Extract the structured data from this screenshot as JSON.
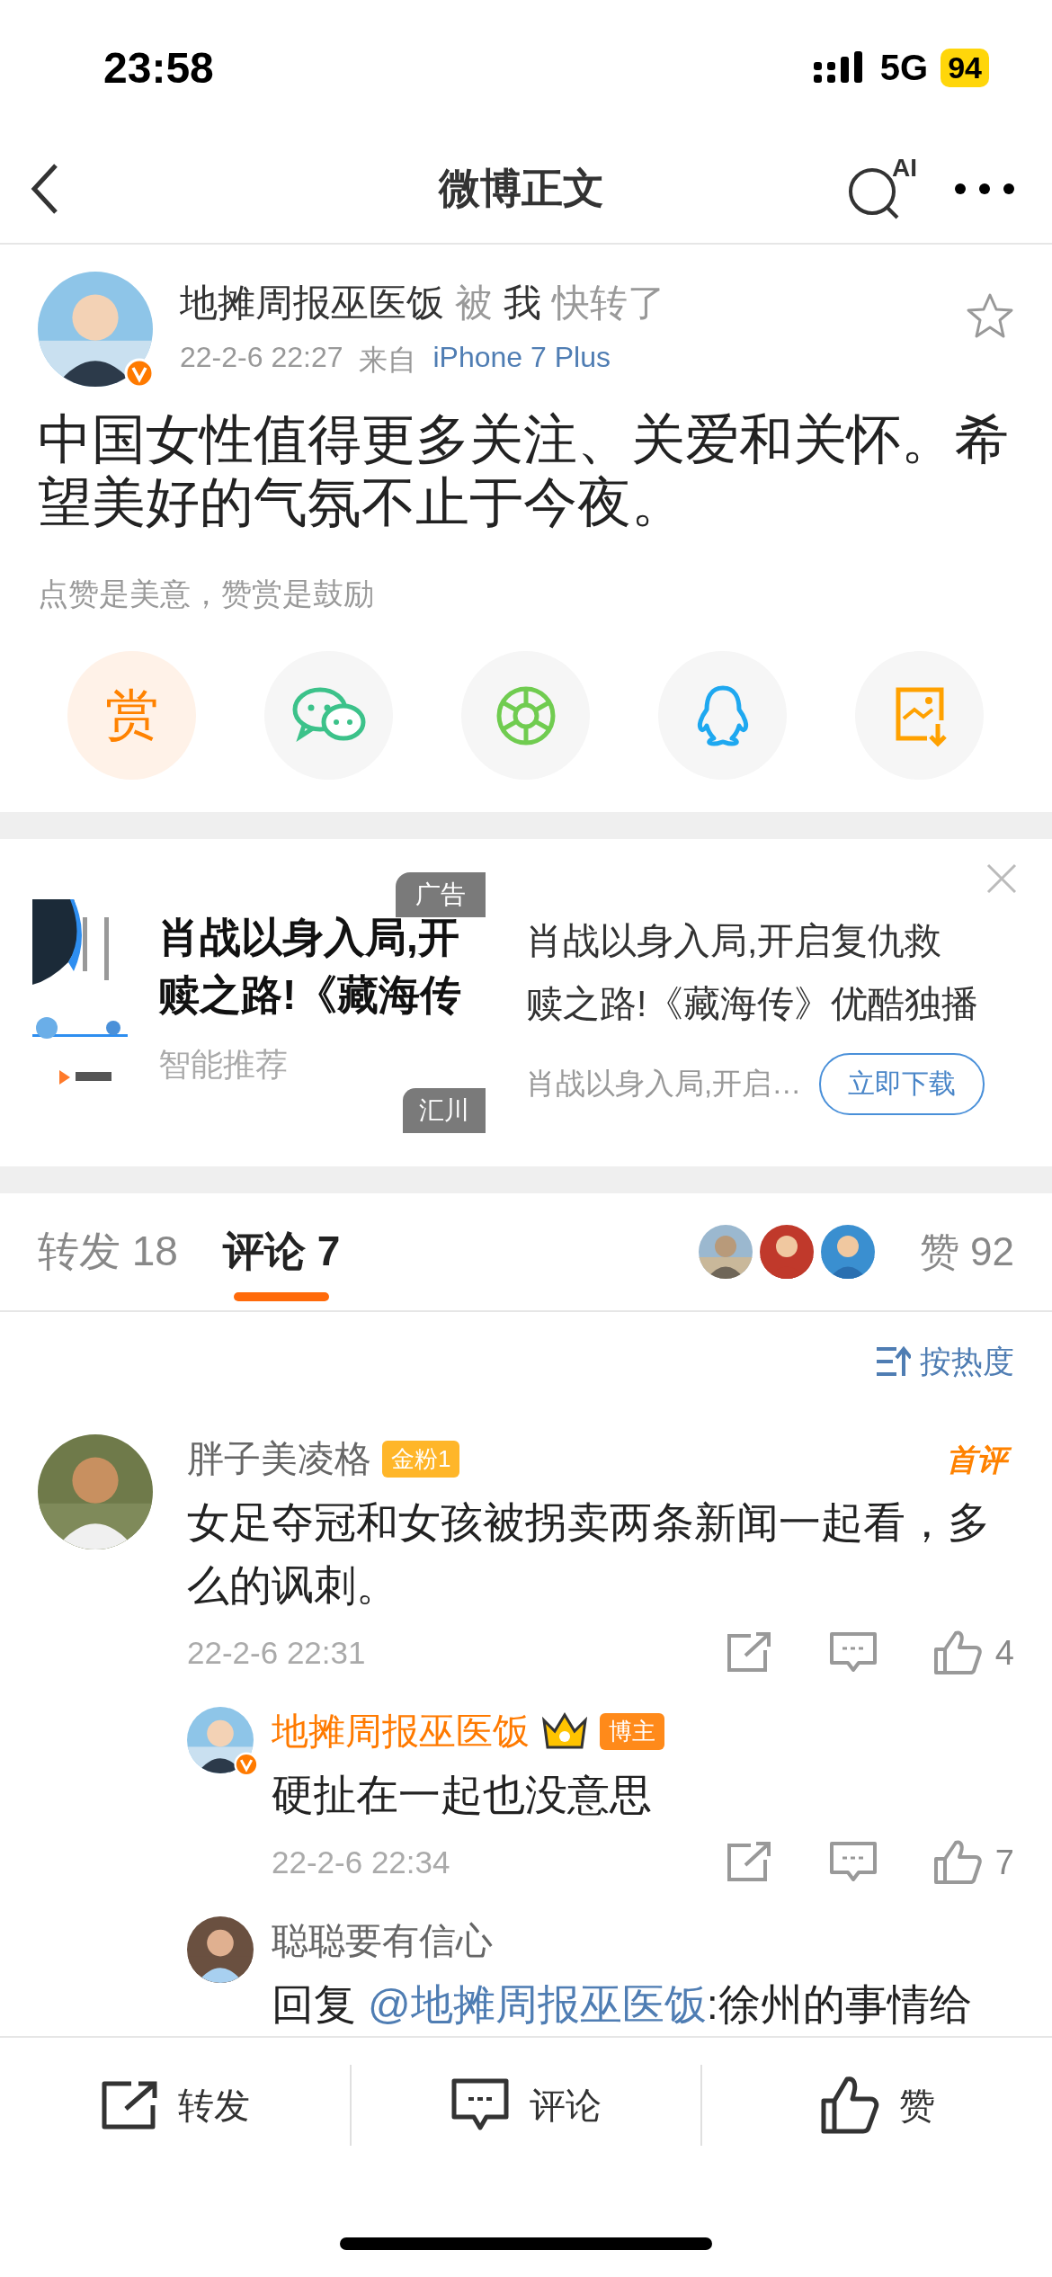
{
  "status_bar": {
    "time": "23:58",
    "network": "5G",
    "battery": "94"
  },
  "nav": {
    "title": "微博正文",
    "ai_label": "AI"
  },
  "post": {
    "author": "地摊周报巫医饭",
    "repost_verb": "被",
    "reposter": "我",
    "repost_action": "快转了",
    "verified": true,
    "starred": false,
    "time": "22-2-6 22:27",
    "source_prefix": "来自",
    "source": "iPhone 7 Plus",
    "text": "中国女性值得更多关注、关爱和关怀。希望美好的气氛不止于今夜。",
    "reward_hint": "点赞是美意，赞赏是鼓励",
    "share": [
      {
        "kind": "reward",
        "glyph": "赏"
      },
      {
        "kind": "wechat"
      },
      {
        "kind": "moments"
      },
      {
        "kind": "qq"
      },
      {
        "kind": "save-image"
      }
    ]
  },
  "ad": {
    "image_title_lines": [
      "肖战以身入局,开",
      "赎之路!《藏海传"
    ],
    "image_caption": "智能推荐",
    "ad_badge": "广告",
    "source_badge": "汇川",
    "title_lines": [
      "肖战以身入局,开启复仇救",
      "赎之路!《藏海传》优酷独播"
    ],
    "subtitle": "肖战以身入局,开启…",
    "cta": "立即下载"
  },
  "tabs": [
    {
      "label": "转发",
      "count": "18",
      "selected": false
    },
    {
      "label": "评论",
      "count": "7",
      "selected": true
    }
  ],
  "likes": {
    "label": "赞",
    "count": "92"
  },
  "sort": {
    "label": "按热度"
  },
  "comments": [
    {
      "author": "胖子美凌格",
      "is_blogger": false,
      "verified": false,
      "badge": {
        "kind": "fan",
        "text": "金粉1"
      },
      "first_label": "首评",
      "text": "女足夺冠和女孩被拐卖两条新闻一起看，多么的讽刺。",
      "time": "22-2-6 22:31",
      "like_count": "4",
      "replies": [
        {
          "author": "地摊周报巫医饭",
          "is_blogger": true,
          "verified": true,
          "badge": {
            "kind": "blogger",
            "text": "博主"
          },
          "text": "硬扯在一起也没意思",
          "time": "22-2-6 22:34",
          "like_count": "7"
        },
        {
          "author": "聪聪要有信心",
          "is_blogger": false,
          "verified": false,
          "reply_prefix": "回复 ",
          "mention": "@地摊周报巫医饭",
          "text": ":徐州的事情给"
        }
      ]
    }
  ],
  "bottom_bar": [
    {
      "kind": "repost",
      "label": "转发"
    },
    {
      "kind": "comment",
      "label": "评论"
    },
    {
      "kind": "like",
      "label": "赞"
    }
  ]
}
